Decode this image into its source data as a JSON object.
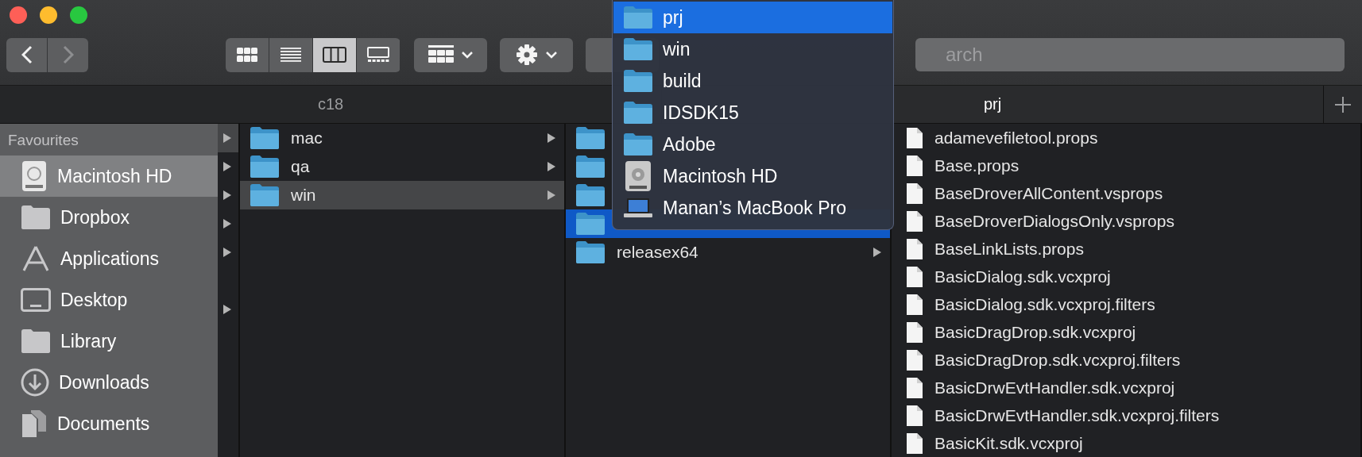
{
  "toolbar": {
    "nav": [
      {
        "kind": "back",
        "disabled": false
      },
      {
        "kind": "forward",
        "disabled": true
      }
    ],
    "view_modes": [
      {
        "kind": "icons",
        "selected": false
      },
      {
        "kind": "list",
        "selected": false
      },
      {
        "kind": "columns",
        "selected": true
      },
      {
        "kind": "gallery",
        "selected": false
      }
    ],
    "search": {
      "placeholder": "arch"
    }
  },
  "tabs": [
    {
      "label": "c18",
      "selected": false
    },
    {
      "label": "prj",
      "selected": true
    }
  ],
  "sidebar": {
    "heading": "Favourites",
    "items": [
      {
        "label": "Macintosh HD",
        "kind": "disk",
        "selected": true
      },
      {
        "label": "Dropbox",
        "kind": "folder",
        "selected": false
      },
      {
        "label": "Applications",
        "kind": "apps",
        "selected": false
      },
      {
        "label": "Desktop",
        "kind": "desktop",
        "selected": false
      },
      {
        "label": "Library",
        "kind": "folder",
        "selected": false
      },
      {
        "label": "Downloads",
        "kind": "downloads",
        "selected": false
      },
      {
        "label": "Documents",
        "kind": "documents",
        "selected": false
      }
    ]
  },
  "columns": [
    {
      "items": [
        {
          "has_children": true,
          "selected": true
        },
        {
          "has_children": true,
          "selected": false
        },
        {
          "has_children": true,
          "selected": false
        },
        {
          "has_children": true,
          "selected": false
        },
        {
          "has_children": true,
          "selected": false
        },
        {
          "selected": false
        },
        {
          "has_children": true,
          "selected": false
        }
      ]
    },
    {
      "items": [
        {
          "name": "mac",
          "kind": "folder",
          "has_children": true,
          "selected": false
        },
        {
          "name": "qa",
          "kind": "folder",
          "has_children": true,
          "selected": false
        },
        {
          "name": "win",
          "kind": "folder",
          "has_children": true,
          "selected": true
        }
      ]
    },
    {
      "items": [
        {
          "kind": "folder",
          "selected": false
        },
        {
          "kind": "folder",
          "selected": false
        },
        {
          "kind": "folder",
          "selected": false
        },
        {
          "kind": "folder",
          "selected": true
        },
        {
          "name": "releasex64",
          "kind": "folder",
          "has_children": true,
          "selected": false
        }
      ]
    },
    {
      "items": [
        {
          "name": "adamevefiletool.props",
          "kind": "file"
        },
        {
          "name": "Base.props",
          "kind": "file"
        },
        {
          "name": "BaseDroverAllContent.vsprops",
          "kind": "file"
        },
        {
          "name": "BaseDroverDialogsOnly.vsprops",
          "kind": "file"
        },
        {
          "name": "BaseLinkLists.props",
          "kind": "file"
        },
        {
          "name": "BasicDialog.sdk.vcxproj",
          "kind": "file"
        },
        {
          "name": "BasicDialog.sdk.vcxproj.filters",
          "kind": "file"
        },
        {
          "name": "BasicDragDrop.sdk.vcxproj",
          "kind": "file"
        },
        {
          "name": "BasicDragDrop.sdk.vcxproj.filters",
          "kind": "file"
        },
        {
          "name": "BasicDrwEvtHandler.sdk.vcxproj",
          "kind": "file"
        },
        {
          "name": "BasicDrwEvtHandler.sdk.vcxproj.filters",
          "kind": "file"
        },
        {
          "name": "BasicKit.sdk.vcxproj",
          "kind": "file"
        }
      ]
    }
  ],
  "path_menu": {
    "items": [
      {
        "label": "prj",
        "kind": "folder",
        "selected": true
      },
      {
        "label": "win",
        "kind": "folder",
        "selected": false
      },
      {
        "label": "build",
        "kind": "folder",
        "selected": false
      },
      {
        "label": "IDSDK15",
        "kind": "folder",
        "selected": false
      },
      {
        "label": "Adobe",
        "kind": "folder",
        "selected": false
      },
      {
        "label": "Macintosh HD",
        "kind": "disk",
        "selected": false
      },
      {
        "label": "Manan’s MacBook Pro",
        "kind": "laptop",
        "selected": false
      }
    ]
  }
}
